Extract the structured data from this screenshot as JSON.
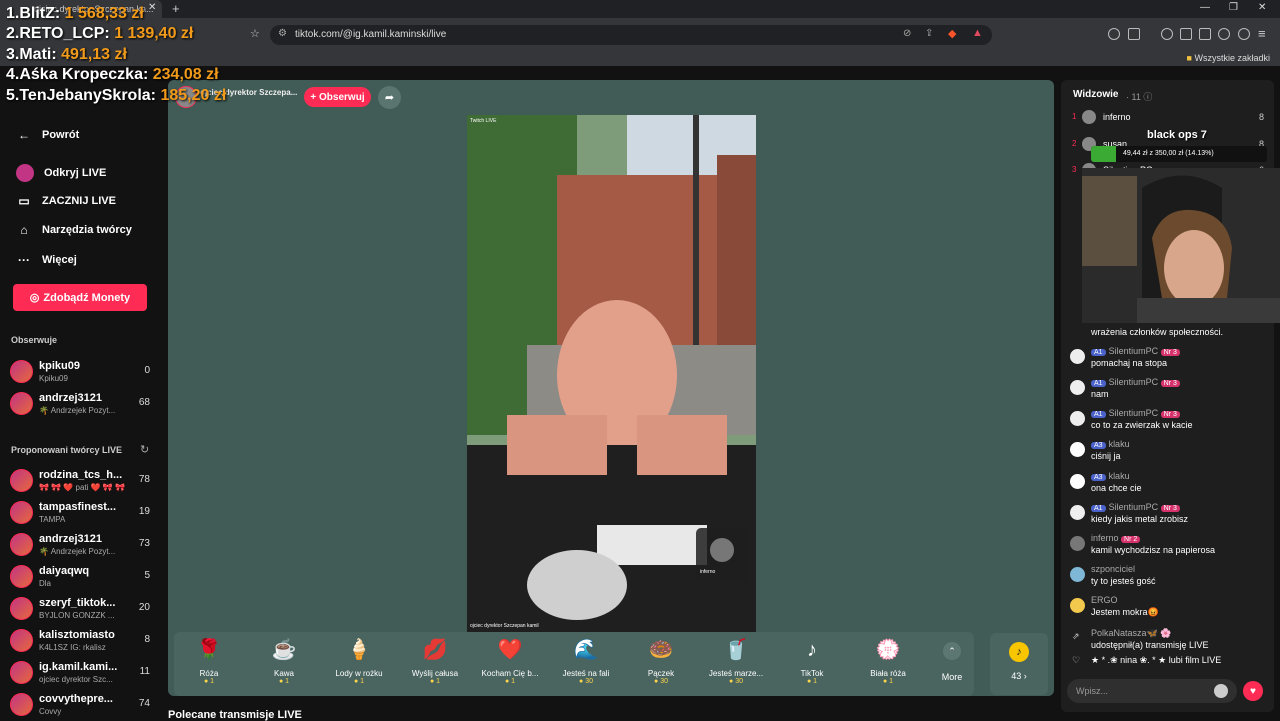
{
  "browser": {
    "tab_title": "ojciec dyrektor Szczepan ka...",
    "url": "tiktok.com/@ig.kamil.kaminski/live",
    "bookmarks_all": "Wszystkie zakładki"
  },
  "leaderboard": [
    {
      "rank": "1.",
      "name": "BlitZ:",
      "amount": "1 568,33 zł"
    },
    {
      "rank": "2.",
      "name": "RETO_LCP:",
      "amount": "1 139,40 zł"
    },
    {
      "rank": "3.",
      "name": "Mati:",
      "amount": "491,13 zł"
    },
    {
      "rank": "4.",
      "name": "Aśka Kropeczka:",
      "amount": "234,08 zł"
    },
    {
      "rank": "5.",
      "name": "TenJebanySkrola:",
      "amount": "185,20 zł"
    }
  ],
  "sidebar": {
    "back": "Powrót",
    "discover": "Odkryj LIVE",
    "go_live": "ZACZNIJ LIVE",
    "creator_tools": "Narzędzia twórcy",
    "more": "Więcej",
    "get_coins": "Zdobądź Monety",
    "following_title": "Obserwuje",
    "following": [
      {
        "name": "kpiku09",
        "sub": "Kpiku09",
        "count": "0"
      },
      {
        "name": "andrzej3121",
        "sub": "🌴 Andrzejek Pozyt...",
        "count": "68"
      }
    ],
    "suggested_title": "Proponowani twórcy LIVE",
    "suggested": [
      {
        "name": "rodzina_tcs_h...",
        "sub": "🎀 🎀 ❤️ pati ❤️ 🎀 🎀",
        "count": "78"
      },
      {
        "name": "tampasfinest...",
        "sub": "TAMPA",
        "count": "19"
      },
      {
        "name": "andrzej3121",
        "sub": "🌴 Andrzejek Pozyt...",
        "count": "73"
      },
      {
        "name": "daiyaqwq",
        "sub": "Dla",
        "count": "5"
      },
      {
        "name": "szeryf_tiktok...",
        "sub": "BYJLON GONZZK ...",
        "count": "20"
      },
      {
        "name": "kalisztomiasto",
        "sub": "K4L1SZ IG: rkalisz",
        "count": "8"
      },
      {
        "name": "ig.kamil.kami...",
        "sub": "ojciec dyrektor Szc...",
        "count": "11"
      },
      {
        "name": "covvythepre...",
        "sub": "Covvy",
        "count": "74"
      }
    ]
  },
  "live": {
    "host_name": "ojciec dyrektor Szczepa...",
    "follow_label": "+ Obserwuj",
    "video_top_label": "Twitch LIVE",
    "video_bottom_label": "ojciec dyrektor Szczepan kamil",
    "pip_label": "inferno",
    "recommended_title": "Polecane transmisje LIVE"
  },
  "gifts": [
    {
      "name": "Róża",
      "price": "1",
      "icon": "🌹"
    },
    {
      "name": "Kawa",
      "price": "1",
      "icon": "☕"
    },
    {
      "name": "Lody w rożku",
      "price": "1",
      "icon": "🍦"
    },
    {
      "name": "Wyślij całusa",
      "price": "1",
      "icon": "💋"
    },
    {
      "name": "Kocham Cię b...",
      "price": "1",
      "icon": "❤️"
    },
    {
      "name": "Jesteś na fali",
      "price": "30",
      "icon": "🌊"
    },
    {
      "name": "Pączek",
      "price": "30",
      "icon": "🍩"
    },
    {
      "name": "Jesteś marze...",
      "price": "30",
      "icon": "🥤"
    },
    {
      "name": "TikTok",
      "price": "1",
      "icon": "♪"
    },
    {
      "name": "Biała róża",
      "price": "1",
      "icon": "💮"
    }
  ],
  "gifts_more": "More",
  "coin_count": "43 ›",
  "viewers": {
    "title": "Widzowie",
    "count": "· 11",
    "list": [
      {
        "rank": "1",
        "name": "inferno",
        "score": "8"
      },
      {
        "rank": "2",
        "name": "susan",
        "score": "8"
      },
      {
        "rank": "3",
        "name": "SilentiumPC",
        "score": "6"
      }
    ]
  },
  "goal": {
    "title": "black ops 7",
    "text": "49,44 zł z 350,00 zł (14.13%)",
    "progress": 0.1413
  },
  "chat": [
    {
      "user": "",
      "badges": [],
      "text": "wrażenia członków społeczności."
    },
    {
      "user": "SilentiumPC",
      "badges": [
        "A1",
        "Nr 3"
      ],
      "text": "pomachaj na stopa"
    },
    {
      "user": "SilentiumPC",
      "badges": [
        "A1",
        "Nr 3"
      ],
      "text": "nam"
    },
    {
      "user": "SilentiumPC",
      "badges": [
        "A1",
        "Nr 3"
      ],
      "text": "co to za zwierzak w kacie"
    },
    {
      "user": "klaku",
      "badges": [
        "A3"
      ],
      "text": "ciśnij ja"
    },
    {
      "user": "klaku",
      "badges": [
        "A3"
      ],
      "text": "ona chce cie"
    },
    {
      "user": "SilentiumPC",
      "badges": [
        "A1",
        "Nr 3"
      ],
      "text": "kiedy jakis metal zrobisz"
    },
    {
      "user": "inferno",
      "badges": [
        "Nr 2"
      ],
      "text": "kamil wychodzisz na papierosa"
    },
    {
      "user": "szponciciel",
      "badges": [],
      "text": "ty to jesteś gość"
    },
    {
      "user": "ERGO",
      "badges": [],
      "text": "Jestem mokra😡"
    },
    {
      "user": "PolkaNatasza🦋 🌸",
      "badges": [],
      "text": "udostępnił(a) transmisję LIVE"
    },
    {
      "user": "",
      "badges": [],
      "text": "★ * .❀ nina ❀. * ★ lubi film LIVE"
    }
  ],
  "chat_placeholder": "Wpisz..."
}
